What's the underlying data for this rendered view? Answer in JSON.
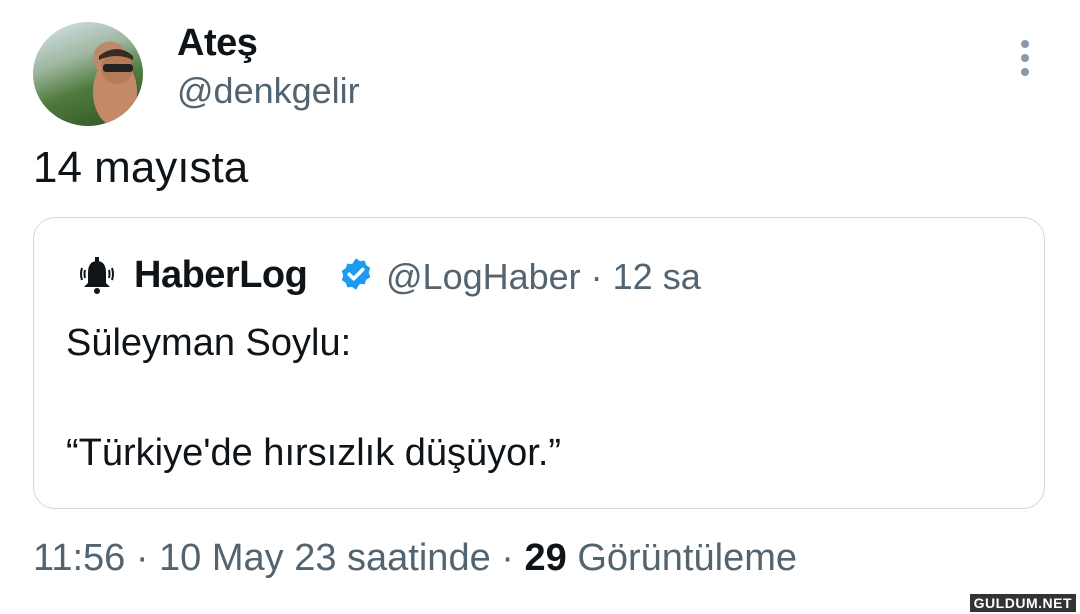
{
  "user": {
    "name": "Ateş",
    "handle": "@denkgelir"
  },
  "tweet": {
    "text": "14 mayısta"
  },
  "quoted": {
    "name": "HaberLog",
    "meta": "@LogHaber · 12 sa",
    "line1": "Süleyman Soylu:",
    "line2": "“Türkiye'de hırsızlık düşüyor.”"
  },
  "footer": {
    "time": "11:56 · 10 May 23 saatinde ·",
    "views_count": "29",
    "views_label": "Görüntüleme"
  },
  "watermark": "GULDUM.NET",
  "colors": {
    "text": "#0f1419",
    "secondary": "#536471",
    "verified": "#1d9bf0",
    "border": "#cfd9de"
  },
  "icons": {
    "more": "more-vertical-icon",
    "verified": "verified-badge-icon",
    "quoted_avatar": "alarm-bell-icon"
  }
}
